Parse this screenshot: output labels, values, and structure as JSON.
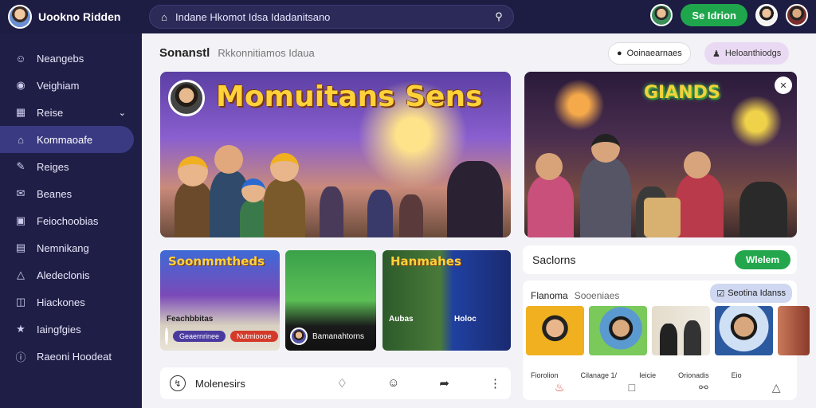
{
  "app": {
    "brand_name": "Uookno Ridden",
    "search_value": "Indane Hkomot Idsa Idadanitsano",
    "top_button": "Se Idrion"
  },
  "sidebar": {
    "items": [
      {
        "label": "Neangebs",
        "icon": "user-icon"
      },
      {
        "label": "Veighiam",
        "icon": "chat-icon"
      },
      {
        "label": "Reise",
        "icon": "grid-icon"
      },
      {
        "label": "Kommaoafe",
        "icon": "home-icon"
      },
      {
        "label": "Reiges",
        "icon": "edit-icon"
      },
      {
        "label": "Beanes",
        "icon": "mail-icon"
      },
      {
        "label": "Feiochoobias",
        "icon": "calendar-icon"
      },
      {
        "label": "Nemnikang",
        "icon": "document-icon"
      },
      {
        "label": "Aledeclonis",
        "icon": "bell-icon"
      },
      {
        "label": "Hiackones",
        "icon": "chart-icon"
      },
      {
        "label": "Iaingfgies",
        "icon": "game-icon"
      },
      {
        "label": "Raeoni Hoodeat",
        "icon": "info-icon"
      }
    ]
  },
  "main": {
    "title": "Sonanstl",
    "subtitle": "Rkkonnitiamos Idaua",
    "chip_white": "Ooinaearnaes",
    "chip_pink": "Heloanthiodgs",
    "hero1_title": "Momuitans Sens",
    "hero2_sign": "GIANDS",
    "card1": {
      "title": "Soonmmtheds",
      "caption": "Feachbbitas",
      "tag1": "Geaernrinee",
      "tag2": "Nutmioooe"
    },
    "card2": {
      "caption": "Bamanahtorns"
    },
    "card3": {
      "title": "Hanmahes",
      "caption": "Aubas",
      "caption2": "Holoc"
    },
    "bottom_bar_text": "Molenesirs"
  },
  "right": {
    "panel_title": "Saclorns",
    "panel_button": "Wlelem",
    "section_title": "Flanoma",
    "section_sub": "Sooeniaes",
    "section_chip": "Seotina Idanss",
    "thumb_labels": [
      "Fiorolion",
      "Cilanage 1/",
      "Ieicie",
      "Orionadis",
      "Eio"
    ]
  },
  "colors": {
    "accent": "#1fa64d",
    "sidebar_bg": "#1f1e46",
    "active_nav": "#3a3a82",
    "brand_yellow": "#ffd23a"
  }
}
